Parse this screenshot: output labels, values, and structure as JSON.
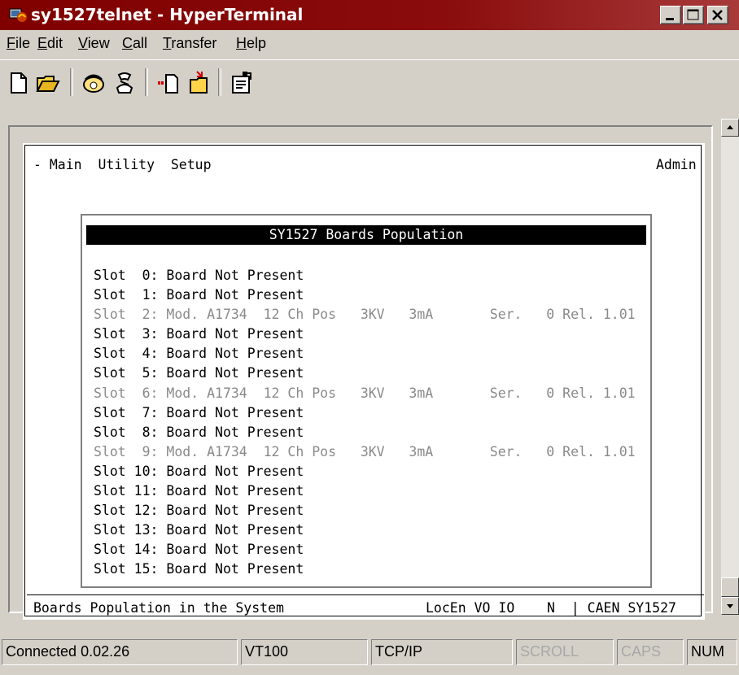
{
  "window": {
    "title": "sy1527telnet - HyperTerminal"
  },
  "menu": [
    {
      "mnemonic": "F",
      "rest": "ile"
    },
    {
      "mnemonic": "E",
      "rest": "dit"
    },
    {
      "mnemonic": "V",
      "rest": "iew"
    },
    {
      "mnemonic": "C",
      "rest": "all"
    },
    {
      "mnemonic": "T",
      "rest": "ransfer"
    },
    {
      "mnemonic": "H",
      "rest": "elp"
    }
  ],
  "toolbar": {
    "icons": [
      "new-icon",
      "open-icon",
      "call-icon",
      "hangup-icon",
      "send-icon",
      "receive-icon",
      "properties-icon"
    ]
  },
  "terminal": {
    "top_menu": "- Main  Utility  Setup",
    "admin": "Admin",
    "popup_title": "SY1527 Boards Population",
    "slots": [
      {
        "text": "Slot  0: Board Not Present",
        "present": false
      },
      {
        "text": "Slot  1: Board Not Present",
        "present": false
      },
      {
        "text": "Slot  2: Mod. A1734  12 Ch Pos   3KV   3mA       Ser.   0 Rel. 1.01",
        "present": true
      },
      {
        "text": "Slot  3: Board Not Present",
        "present": false
      },
      {
        "text": "Slot  4: Board Not Present",
        "present": false
      },
      {
        "text": "Slot  5: Board Not Present",
        "present": false
      },
      {
        "text": "Slot  6: Mod. A1734  12 Ch Pos   3KV   3mA       Ser.   0 Rel. 1.01",
        "present": true
      },
      {
        "text": "Slot  7: Board Not Present",
        "present": false
      },
      {
        "text": "Slot  8: Board Not Present",
        "present": false
      },
      {
        "text": "Slot  9: Mod. A1734  12 Ch Pos   3KV   3mA       Ser.   0 Rel. 1.01",
        "present": true
      },
      {
        "text": "Slot 10: Board Not Present",
        "present": false
      },
      {
        "text": "Slot 11: Board Not Present",
        "present": false
      },
      {
        "text": "Slot 12: Board Not Present",
        "present": false
      },
      {
        "text": "Slot 13: Board Not Present",
        "present": false
      },
      {
        "text": "Slot 14: Board Not Present",
        "present": false
      },
      {
        "text": "Slot 15: Board Not Present",
        "present": false
      }
    ],
    "status_left": "Boards Population in the System",
    "status_right": "LocEn VO IO    N  | CAEN SY1527"
  },
  "statusbar": {
    "connected": "Connected 0.02.26",
    "emulation": "VT100",
    "protocol": "TCP/IP",
    "scroll": "SCROLL",
    "caps": "CAPS",
    "num": "NUM"
  },
  "colors": {
    "titlebar": "#800000",
    "chrome": "#d4d0c8",
    "dim_text": "#8a8a8a"
  }
}
